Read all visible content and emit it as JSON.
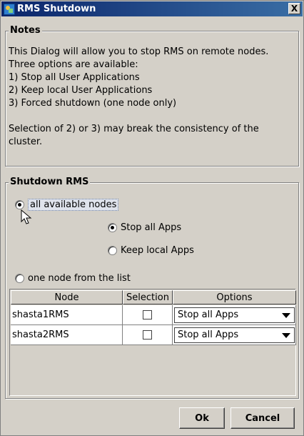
{
  "window": {
    "title": "RMS Shutdown",
    "close_label": "X"
  },
  "notes": {
    "title": "Notes",
    "lines": [
      "This Dialog will allow you to stop RMS on remote nodes.",
      "Three options are available:",
      "1) Stop all User Applications",
      "2) Keep local User Applications",
      "3) Forced shutdown (one node only)",
      "",
      "Selection of 2) or 3) may break the consistency of the",
      "cluster."
    ]
  },
  "shutdown": {
    "title": "Shutdown RMS",
    "all_nodes_label": "all available nodes",
    "all_nodes_selected": true,
    "stop_all_apps_label": "Stop all Apps",
    "stop_all_apps_selected": true,
    "keep_local_apps_label": "Keep local Apps",
    "keep_local_apps_selected": false,
    "one_node_label": "one node from the list",
    "one_node_selected": false
  },
  "table": {
    "headers": [
      "Node",
      "Selection",
      "Options"
    ],
    "rows": [
      {
        "node": "shasta1RMS",
        "selected": false,
        "option": "Stop all Apps"
      },
      {
        "node": "shasta2RMS",
        "selected": false,
        "option": "Stop all Apps"
      }
    ]
  },
  "buttons": {
    "ok": "Ok",
    "cancel": "Cancel"
  }
}
